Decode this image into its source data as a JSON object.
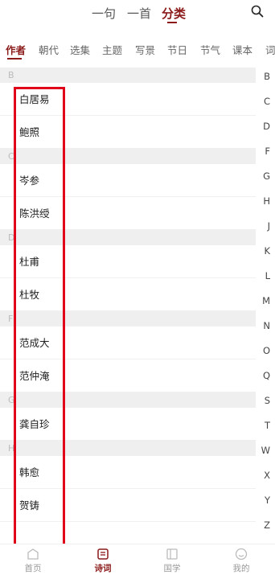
{
  "top_tabs": [
    "一句",
    "一首",
    "分类"
  ],
  "categories": [
    "作者",
    "朝代",
    "选集",
    "主题",
    "写景",
    "节日",
    "节气",
    "课本",
    "词"
  ],
  "sections": [
    {
      "letter": "B",
      "items": [
        "白居易",
        "鲍照"
      ]
    },
    {
      "letter": "C",
      "items": [
        "岑参",
        "陈洪绶"
      ]
    },
    {
      "letter": "D",
      "items": [
        "杜甫",
        "杜牧"
      ]
    },
    {
      "letter": "F",
      "items": [
        "范成大",
        "范仲淹"
      ]
    },
    {
      "letter": "G",
      "items": [
        "龚自珍"
      ]
    },
    {
      "letter": "H",
      "items": [
        "韩愈",
        "贺铸"
      ]
    }
  ],
  "alphabet": [
    "B",
    "C",
    "D",
    "F",
    "G",
    "H",
    "J",
    "K",
    "L",
    "M",
    "N",
    "O",
    "Q",
    "S",
    "T",
    "W",
    "X",
    "Y",
    "Z"
  ],
  "bottom_nav": [
    "首页",
    "诗词",
    "国学",
    "我的"
  ],
  "colors": {
    "accent": "#8b1a1a",
    "highlight": "#e0001a"
  }
}
